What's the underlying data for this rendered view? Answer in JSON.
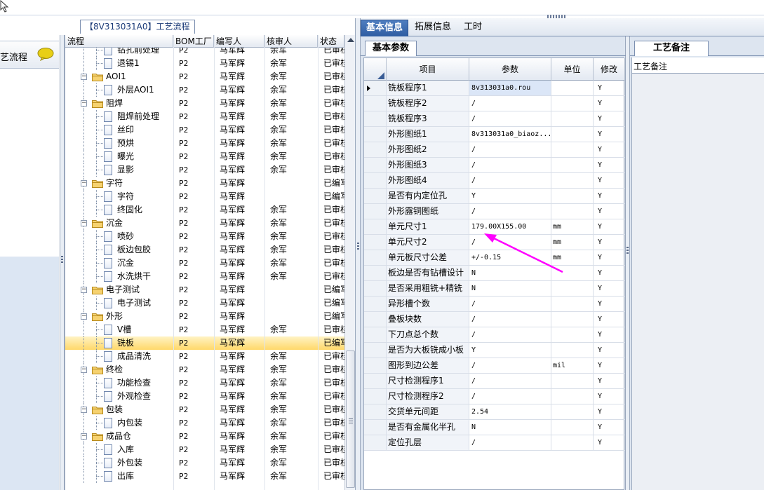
{
  "left_panel": {
    "nav_label": "艺流程"
  },
  "tree_panel": {
    "title": "【8V313031A0】工艺流程",
    "columns": [
      "流程",
      "BOM工厂",
      "编写人",
      "核审人",
      "状态"
    ],
    "rows": [
      {
        "level": 2,
        "type": "doc",
        "label": "钻孔前处理",
        "bom": "P2",
        "writer": "马军辉",
        "reviewer": "余军",
        "status": "已审核"
      },
      {
        "level": 2,
        "type": "doc",
        "label": "退锡1",
        "bom": "P2",
        "writer": "马军辉",
        "reviewer": "余军",
        "status": "已审核"
      },
      {
        "level": 1,
        "type": "folder",
        "label": "AOI1",
        "bom": "P2",
        "writer": "马军辉",
        "reviewer": "余军",
        "status": "已审核"
      },
      {
        "level": 2,
        "type": "doc",
        "label": "外层AOI1",
        "bom": "P2",
        "writer": "马军辉",
        "reviewer": "余军",
        "status": "已审核"
      },
      {
        "level": 1,
        "type": "folder",
        "label": "阻焊",
        "bom": "P2",
        "writer": "马军辉",
        "reviewer": "余军",
        "status": "已审核"
      },
      {
        "level": 2,
        "type": "doc",
        "label": "阻焊前处理",
        "bom": "P2",
        "writer": "马军辉",
        "reviewer": "余军",
        "status": "已审核"
      },
      {
        "level": 2,
        "type": "doc",
        "label": "丝印",
        "bom": "P2",
        "writer": "马军辉",
        "reviewer": "余军",
        "status": "已审核"
      },
      {
        "level": 2,
        "type": "doc",
        "label": "预烘",
        "bom": "P2",
        "writer": "马军辉",
        "reviewer": "余军",
        "status": "已审核"
      },
      {
        "level": 2,
        "type": "doc",
        "label": "曝光",
        "bom": "P2",
        "writer": "马军辉",
        "reviewer": "余军",
        "status": "已审核"
      },
      {
        "level": 2,
        "type": "doc",
        "label": "显影",
        "bom": "P2",
        "writer": "马军辉",
        "reviewer": "余军",
        "status": "已审核"
      },
      {
        "level": 1,
        "type": "folder",
        "label": "字符",
        "bom": "P2",
        "writer": "马军辉",
        "reviewer": "",
        "status": "已编写"
      },
      {
        "level": 2,
        "type": "doc",
        "label": "字符",
        "bom": "P2",
        "writer": "马军辉",
        "reviewer": "",
        "status": "已编写"
      },
      {
        "level": 2,
        "type": "doc",
        "label": "终固化",
        "bom": "P2",
        "writer": "马军辉",
        "reviewer": "余军",
        "status": "已审核"
      },
      {
        "level": 1,
        "type": "folder",
        "label": "沉金",
        "bom": "P2",
        "writer": "马军辉",
        "reviewer": "余军",
        "status": "已审核"
      },
      {
        "level": 2,
        "type": "doc",
        "label": "喷砂",
        "bom": "P2",
        "writer": "马军辉",
        "reviewer": "余军",
        "status": "已审核"
      },
      {
        "level": 2,
        "type": "doc",
        "label": "板边包胶",
        "bom": "P2",
        "writer": "马军辉",
        "reviewer": "余军",
        "status": "已审核"
      },
      {
        "level": 2,
        "type": "doc",
        "label": "沉金",
        "bom": "P2",
        "writer": "马军辉",
        "reviewer": "余军",
        "status": "已审核"
      },
      {
        "level": 2,
        "type": "doc",
        "label": "水洗烘干",
        "bom": "P2",
        "writer": "马军辉",
        "reviewer": "余军",
        "status": "已审核"
      },
      {
        "level": 1,
        "type": "folder",
        "label": "电子测试",
        "bom": "P2",
        "writer": "马军辉",
        "reviewer": "",
        "status": "已编写"
      },
      {
        "level": 2,
        "type": "doc",
        "label": "电子测试",
        "bom": "P2",
        "writer": "马军辉",
        "reviewer": "",
        "status": "已编写"
      },
      {
        "level": 1,
        "type": "folder",
        "label": "外形",
        "bom": "P2",
        "writer": "马军辉",
        "reviewer": "",
        "status": "已编写"
      },
      {
        "level": 2,
        "type": "doc",
        "label": "V槽",
        "bom": "P2",
        "writer": "马军辉",
        "reviewer": "余军",
        "status": "已审核"
      },
      {
        "level": 2,
        "type": "doc",
        "label": "铣板",
        "bom": "P2",
        "writer": "马军辉",
        "reviewer": "",
        "status": "已编写",
        "selected": true
      },
      {
        "level": 2,
        "type": "doc",
        "label": "成品清洗",
        "bom": "P2",
        "writer": "马军辉",
        "reviewer": "余军",
        "status": "已审核"
      },
      {
        "level": 1,
        "type": "folder",
        "label": "终检",
        "bom": "P2",
        "writer": "马军辉",
        "reviewer": "余军",
        "status": "已审核"
      },
      {
        "level": 2,
        "type": "doc",
        "label": "功能检查",
        "bom": "P2",
        "writer": "马军辉",
        "reviewer": "余军",
        "status": "已审核"
      },
      {
        "level": 2,
        "type": "doc",
        "label": "外观检查",
        "bom": "P2",
        "writer": "马军辉",
        "reviewer": "余军",
        "status": "已审核"
      },
      {
        "level": 1,
        "type": "folder",
        "label": "包装",
        "bom": "P2",
        "writer": "马军辉",
        "reviewer": "余军",
        "status": "已审核"
      },
      {
        "level": 2,
        "type": "doc",
        "label": "内包装",
        "bom": "P2",
        "writer": "马军辉",
        "reviewer": "余军",
        "status": "已审核"
      },
      {
        "level": 1,
        "type": "folder",
        "label": "成品仓",
        "bom": "P2",
        "writer": "马军辉",
        "reviewer": "余军",
        "status": "已审核"
      },
      {
        "level": 2,
        "type": "doc",
        "label": "入库",
        "bom": "P2",
        "writer": "马军辉",
        "reviewer": "余军",
        "status": "已审核"
      },
      {
        "level": 2,
        "type": "doc",
        "label": "外包装",
        "bom": "P2",
        "writer": "马军辉",
        "reviewer": "余军",
        "status": "已审核"
      },
      {
        "level": 2,
        "type": "doc",
        "label": "出库",
        "bom": "P2",
        "writer": "马军辉",
        "reviewer": "余军",
        "status": "已审核"
      }
    ]
  },
  "tabs": [
    {
      "label": "基本信息",
      "active": true
    },
    {
      "label": "拓展信息",
      "active": false
    },
    {
      "label": "工时",
      "active": false
    }
  ],
  "param_panel": {
    "tab_label": "基本参数",
    "columns": [
      "项目",
      "参数",
      "单位",
      "修改"
    ],
    "rows": [
      {
        "item": "铣板程序1",
        "param": "8v313031a0.rou",
        "unit": "",
        "mod": "Y",
        "current": true
      },
      {
        "item": "铣板程序2",
        "param": "/",
        "unit": "",
        "mod": "Y"
      },
      {
        "item": "铣板程序3",
        "param": "/",
        "unit": "",
        "mod": "Y"
      },
      {
        "item": "外形图纸1",
        "param": "8v313031a0_biaoz...",
        "unit": "",
        "mod": "Y"
      },
      {
        "item": "外形图纸2",
        "param": "/",
        "unit": "",
        "mod": "Y"
      },
      {
        "item": "外形图纸3",
        "param": "/",
        "unit": "",
        "mod": "Y"
      },
      {
        "item": "外形图纸4",
        "param": "/",
        "unit": "",
        "mod": "Y"
      },
      {
        "item": "是否有内定位孔",
        "param": "Y",
        "unit": "",
        "mod": "Y"
      },
      {
        "item": "外形露铜图纸",
        "param": "/",
        "unit": "",
        "mod": "Y"
      },
      {
        "item": "单元尺寸1",
        "param": "179.00X155.00",
        "unit": "mm",
        "mod": "Y"
      },
      {
        "item": "单元尺寸2",
        "param": "/",
        "unit": "mm",
        "mod": "Y"
      },
      {
        "item": "单元板尺寸公差",
        "param": "+/-0.15",
        "unit": "mm",
        "mod": "Y"
      },
      {
        "item": "板边是否有钻槽设计",
        "param": "N",
        "unit": "",
        "mod": "Y"
      },
      {
        "item": "是否采用粗铣+精铣",
        "param": "N",
        "unit": "",
        "mod": "Y"
      },
      {
        "item": "异形槽个数",
        "param": "/",
        "unit": "",
        "mod": "Y"
      },
      {
        "item": "叠板块数",
        "param": "/",
        "unit": "",
        "mod": "Y"
      },
      {
        "item": "下刀点总个数",
        "param": "/",
        "unit": "",
        "mod": "Y"
      },
      {
        "item": "是否为大板铣成小板",
        "param": "Y",
        "unit": "",
        "mod": "Y"
      },
      {
        "item": "图形到边公差",
        "param": "/",
        "unit": "mil",
        "mod": "Y"
      },
      {
        "item": "尺寸检测程序1",
        "param": "/",
        "unit": "",
        "mod": "Y"
      },
      {
        "item": "尺寸检测程序2",
        "param": "/",
        "unit": "",
        "mod": "Y"
      },
      {
        "item": "交货单元间距",
        "param": "2.54",
        "unit": "",
        "mod": "Y"
      },
      {
        "item": "是否有金属化半孔",
        "param": "N",
        "unit": "",
        "mod": "Y"
      },
      {
        "item": "定位孔层",
        "param": "/",
        "unit": "",
        "mod": "Y"
      }
    ]
  },
  "notes_panel": {
    "tab_label": "工艺备注",
    "field_label": "工艺备注"
  },
  "colors": {
    "accent_tab": "#2f5da2",
    "selection": "#ffd86a",
    "annotation_arrow": "#ff00ff"
  }
}
